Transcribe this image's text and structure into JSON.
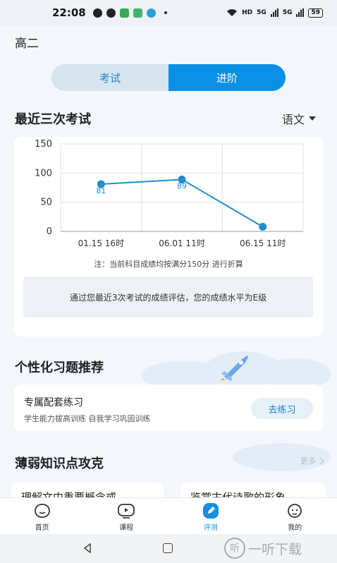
{
  "status_bar": {
    "time": "22:08",
    "network_labels": [
      "HD",
      "5G",
      "5G"
    ],
    "battery": "59"
  },
  "grade": "高二",
  "segmented": {
    "exam_label": "考试",
    "advanced_label": "进阶",
    "active": "进阶"
  },
  "recent_exams": {
    "title": "最近三次考试",
    "subject": "语文"
  },
  "chart_data": {
    "type": "line",
    "categories": [
      "01.15 16时",
      "06.01 11时",
      "06.15 11时"
    ],
    "values": [
      81,
      89,
      8
    ],
    "data_labels": [
      "81",
      "89",
      ""
    ],
    "y_ticks": [
      "150",
      "100",
      "50",
      "0"
    ],
    "ylim": [
      0,
      150
    ],
    "grid": true,
    "color": "#1f8fcb"
  },
  "chart_note": "注：当前科目成绩均按满分150分 进行折算",
  "evaluation_text": "通过您最近3次考试的成绩评估，您的成绩水平为E级",
  "recommend": {
    "title": "个性化习题推荐",
    "card_title": "专属配套练习",
    "card_subtitle": "学生能力拔高训练 自我学习巩固训练",
    "button": "去练习"
  },
  "weak_points": {
    "title": "薄弱知识点攻克",
    "more": "更多",
    "cards": [
      "理解文中重要概念或",
      "鉴赏古代诗歌的形象"
    ]
  },
  "bottom_nav": {
    "items": [
      {
        "label": "首页",
        "icon": "home-face-icon"
      },
      {
        "label": "课程",
        "icon": "course-play-icon"
      },
      {
        "label": "评测",
        "icon": "assessment-pen-icon"
      },
      {
        "label": "我的",
        "icon": "profile-face-icon"
      }
    ],
    "active": "评测"
  },
  "watermark": "一听下载"
}
